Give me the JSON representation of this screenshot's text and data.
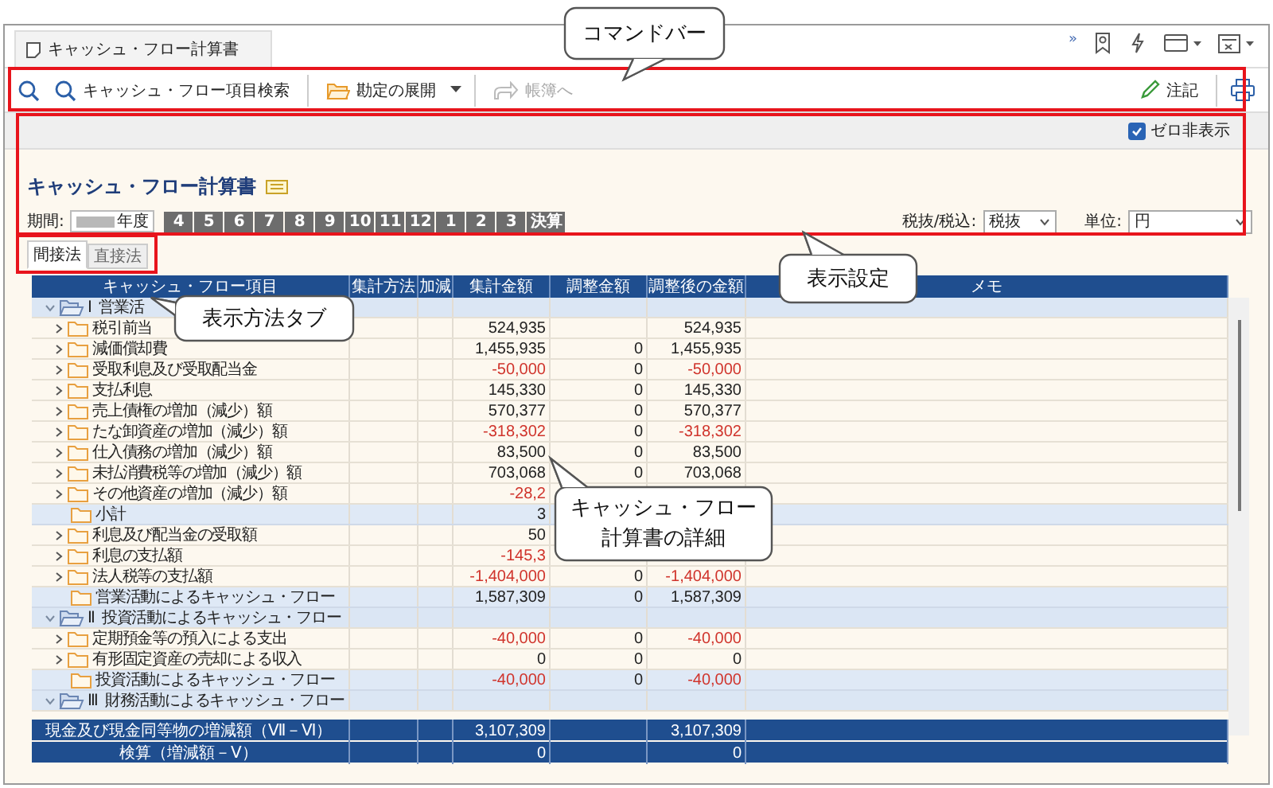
{
  "tab": {
    "title": "キャッシュ・フロー計算書"
  },
  "toolbar_overflow": "»",
  "command_bar": {
    "buttons": [
      {
        "kind": "search",
        "label": "キャッシュ・フロー項目検索",
        "disabled": false
      },
      {
        "kind": "expand",
        "label": "勘定の展開",
        "disabled": false
      },
      {
        "kind": "ledger",
        "label": "帳簿へ",
        "disabled": true
      }
    ],
    "right_buttons": [
      {
        "kind": "note",
        "label": "注記",
        "disabled": false
      }
    ]
  },
  "zero_hide": {
    "label": "ゼロ非表示",
    "checked": true
  },
  "report": {
    "title": "キャッシュ・フロー計算書",
    "period_label": "期間:",
    "year_suffix": "年度",
    "months": [
      {
        "label": "4"
      },
      {
        "label": "5"
      },
      {
        "label": "6"
      },
      {
        "label": "7"
      },
      {
        "label": "8"
      },
      {
        "label": "9"
      },
      {
        "label": "10"
      },
      {
        "label": "11"
      },
      {
        "label": "12"
      },
      {
        "label": "1"
      },
      {
        "label": "2"
      },
      {
        "label": "3"
      },
      {
        "label": "決算"
      }
    ],
    "tax": {
      "label": "税抜/税込:",
      "value": "税抜"
    },
    "unit": {
      "label": "単位:",
      "value": "円"
    }
  },
  "method_tabs": [
    {
      "label": "間接法",
      "selected": true
    },
    {
      "label": "直接法",
      "selected": false
    }
  ],
  "table": {
    "columns": [
      "キャッシュ・フロー項目",
      "集計方法",
      "加減",
      "集計金額",
      "調整金額",
      "調整後の金額",
      "メモ"
    ],
    "rows": [
      {
        "kind": "section",
        "numeral": "Ⅰ",
        "label": "営業活",
        "expanded": true
      },
      {
        "kind": "item",
        "label": "税引前当",
        "amount": "524,935",
        "adjusted": "524,935",
        "negative": false
      },
      {
        "kind": "item",
        "label": "減価償却費",
        "amount": "1,455,935",
        "adjustment": "0",
        "adjusted": "1,455,935",
        "negative": false
      },
      {
        "kind": "item",
        "label": "受取利息及び受取配当金",
        "amount": "-50,000",
        "adjustment": "0",
        "adjusted": "-50,000",
        "negative": true
      },
      {
        "kind": "item",
        "label": "支払利息",
        "amount": "145,330",
        "adjustment": "0",
        "adjusted": "145,330",
        "negative": false
      },
      {
        "kind": "item",
        "label": "売上債権の増加（減少）額",
        "amount": "570,377",
        "adjustment": "0",
        "adjusted": "570,377",
        "negative": false
      },
      {
        "kind": "item",
        "label": "たな卸資産の増加（減少）額",
        "amount": "-318,302",
        "adjustment": "0",
        "adjusted": "-318,302",
        "negative": true
      },
      {
        "kind": "item",
        "label": "仕入債務の増加（減少）額",
        "amount": "83,500",
        "adjustment": "0",
        "adjusted": "83,500",
        "negative": false
      },
      {
        "kind": "item",
        "label": "未払消費税等の増加（減少）額",
        "amount": "703,068",
        "adjustment": "0",
        "adjusted": "703,068",
        "negative": false
      },
      {
        "kind": "item",
        "label": "その他資産の増加（減少）額",
        "amount": "-28,2",
        "negative": true
      },
      {
        "kind": "subtotal",
        "label": "小計",
        "amount": "3",
        "negative": false
      },
      {
        "kind": "item",
        "label": "利息及び配当金の受取額",
        "amount": "50",
        "negative": false
      },
      {
        "kind": "item",
        "label": "利息の支払額",
        "amount": "-145,3",
        "negative": true
      },
      {
        "kind": "item",
        "label": "法人税等の支払額",
        "amount": "-1,404,000",
        "adjustment": "0",
        "adjusted": "-1,404,000",
        "negative": true
      },
      {
        "kind": "subtotal",
        "label": "営業活動によるキャッシュ・フロー",
        "amount": "1,587,309",
        "adjustment": "0",
        "adjusted": "1,587,309",
        "negative": false
      },
      {
        "kind": "section",
        "numeral": "Ⅱ",
        "label": "投資活動によるキャッシュ・フロー",
        "expanded": true
      },
      {
        "kind": "item",
        "label": "定期預金等の預入による支出",
        "amount": "-40,000",
        "adjustment": "0",
        "adjusted": "-40,000",
        "negative": true
      },
      {
        "kind": "item",
        "label": "有形固定資産の売却による収入",
        "amount": "0",
        "adjustment": "0",
        "adjusted": "0",
        "negative": false
      },
      {
        "kind": "subtotal",
        "label": "投資活動によるキャッシュ・フロー",
        "amount": "-40,000",
        "adjustment": "0",
        "adjusted": "-40,000",
        "negative": true
      },
      {
        "kind": "section",
        "numeral": "Ⅲ",
        "label": "財務活動によるキャッシュ・フロー",
        "expanded": true
      }
    ],
    "totals": [
      {
        "label": "現金及び現金同等物の増減額（Ⅶ－Ⅵ）",
        "amount": "3,107,309",
        "adjusted": "3,107,309"
      },
      {
        "label": "検算（増減額－Ⅴ）",
        "amount": "0",
        "adjusted": "0"
      }
    ]
  },
  "callouts": [
    {
      "lines": [
        "コマンドバー"
      ]
    },
    {
      "lines": [
        "表示設定"
      ]
    },
    {
      "lines": [
        "表示方法タブ"
      ]
    },
    {
      "lines": [
        "キャッシュ・フロー",
        "計算書の詳細"
      ]
    }
  ]
}
